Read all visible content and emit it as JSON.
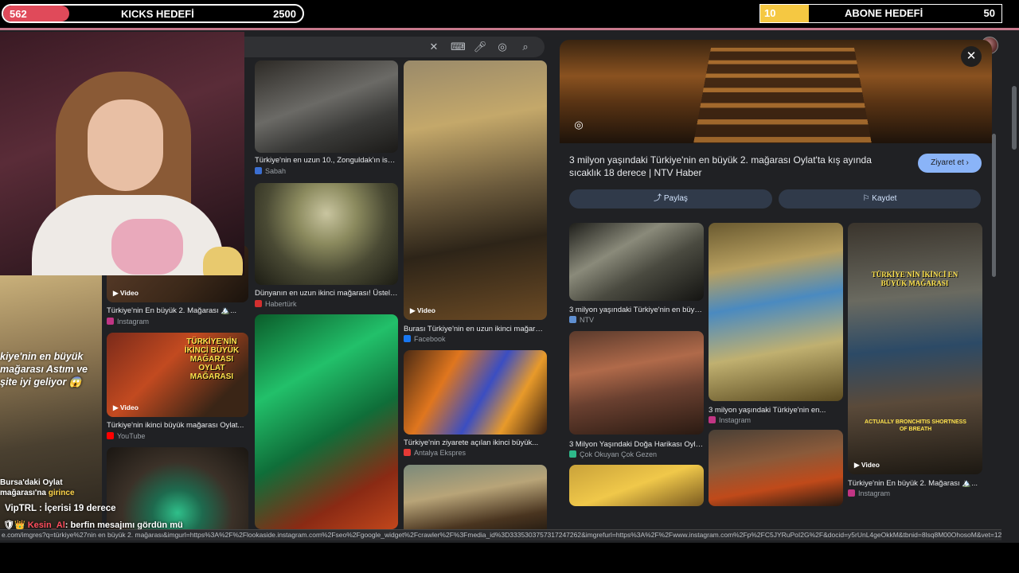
{
  "overlay": {
    "kicks_goal": {
      "current": "562",
      "title": "KICKS HEDEFİ",
      "target": "2500",
      "progress": 0.22,
      "fill_color": "#e04a5a"
    },
    "abone_goal": {
      "current": "10",
      "title": "ABONE HEDEFİ",
      "target": "50",
      "progress": 0.2,
      "fill_color": "#f5c842"
    },
    "alert_big": "kiye'nin en büyük mağarası Astım ve şite iyi geliyor 😱",
    "alert_small_pre": "Bursa'daki Oylat mağarası'na ",
    "alert_small_hl": "girince",
    "chat_line1": "VipTRL : İçerisi 19 derece",
    "chat_line2_name": "Kesin_Al",
    "chat_line2_text": ": berfin mesajımı gördün mü"
  },
  "search": {
    "icons": [
      "close-icon",
      "keyboard-icon",
      "mic-icon",
      "lens-icon",
      "search-icon"
    ]
  },
  "results": {
    "col1": [
      {
        "caption": "Türkiye'nin En büyük 2. Mağarası 🏔️...",
        "source": "Instagram",
        "video": "Video",
        "fav": "#c13584"
      },
      {
        "caption": "Türkiye'nin ikinci büyük mağarası Oylat...",
        "source": "YouTube",
        "video": "Video",
        "fav": "#ff0000",
        "overlay_text": "TÜRKİYE'NİN İKİNCİ BÜYÜK MAĞARASI OYLAT MAĞARASI"
      }
    ],
    "col2": [
      {
        "caption": "Türkiye'nin en uzun 10., Zonguldak'ın ise e...",
        "source": "Sabah",
        "fav": "#3b6fd1"
      },
      {
        "caption": "Dünyanın en uzun ikinci mağarası! Üstelik...",
        "source": "Habertürk",
        "fav": "#d32f2f"
      }
    ],
    "col3": [
      {
        "caption": "Burası Türkiye'nin en uzun ikinci mağarası...",
        "source": "Facebook",
        "video": "Video",
        "fav": "#1877f2"
      },
      {
        "caption": "Türkiye'nin ziyarete açılan ikinci büyük...",
        "source": "Antalya Ekspres",
        "fav": "#e53935"
      }
    ]
  },
  "panel": {
    "title": "3 milyon yaşındaki Türkiye'nin en büyük 2. mağarası Oylat'ta kış ayında sıcaklık 18 derece | NTV Haber",
    "visit_label": "Ziyaret et ›",
    "share_label": "Paylaş",
    "save_label": "Kaydet",
    "related": [
      {
        "caption": "3 milyon yaşındaki Türkiye'nin en büyük...",
        "source": "NTV",
        "fav": "#5f8fd0"
      },
      {
        "caption": "3 Milyon Yaşındaki Doğa Harikası Oylat...",
        "source": "Çok Okuyan Çok Gezen",
        "fav": "#2eb88a"
      },
      {
        "caption": "3 milyon yaşındaki Türkiye'nin en...",
        "source": "Instagram",
        "fav": "#c13584"
      },
      {
        "caption": "Türkiye'nin En büyük 2. Mağarası 🏔️...",
        "source": "Instagram",
        "video": "Video",
        "fav": "#c13584",
        "overlay_text": "TÜRKİYE'NİN İKİNCİ EN BÜYÜK MAĞARASI",
        "overlay_sub": "ACTUALLY BRONCHITIS SHORTNESS OF BREATH"
      }
    ]
  },
  "status_url": "e.com/imgres?q=türkiye%27nin en büyük 2. mağarası&imgurl=https%3A%2F%2Flookaside.instagram.com%2Fseo%2Fgoogle_widget%2Fcrawler%2F%3Fmedia_id%3D3335303757317247262&imgrefurl=https%3A%2F%2Fwww.instagram.com%2Fp%2FC5JYRuPoI2G%2F&docid=y5rUnL4geOkkM&tbnid=8lsq8M00OhosoM&vet=12ahU..."
}
